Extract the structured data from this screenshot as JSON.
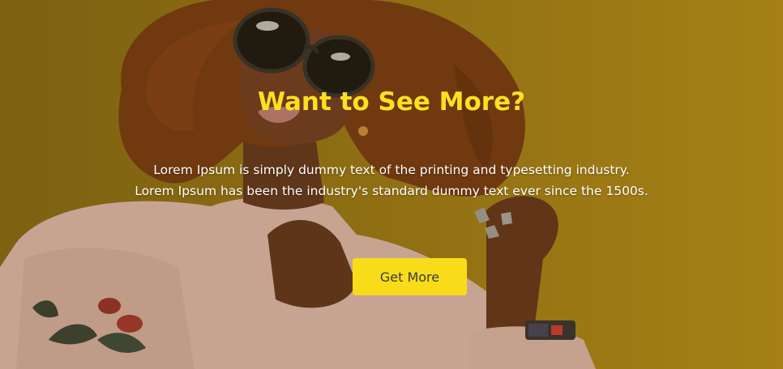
{
  "hero": {
    "title": "Want to See More?",
    "description_lines": [
      "Lorem Ipsum is simply dummy text of the printing and typesetting industry.",
      "Lorem Ipsum has been the industry's standard dummy text ever since the 1500s."
    ],
    "button_label": "Get More"
  },
  "colors": {
    "background": "#8e6f14",
    "title": "#fde021",
    "text": "#ffffff",
    "button": "#f8dc1a",
    "button_text": "#3b3b3b"
  },
  "icons": [
    "hero-photo"
  ]
}
